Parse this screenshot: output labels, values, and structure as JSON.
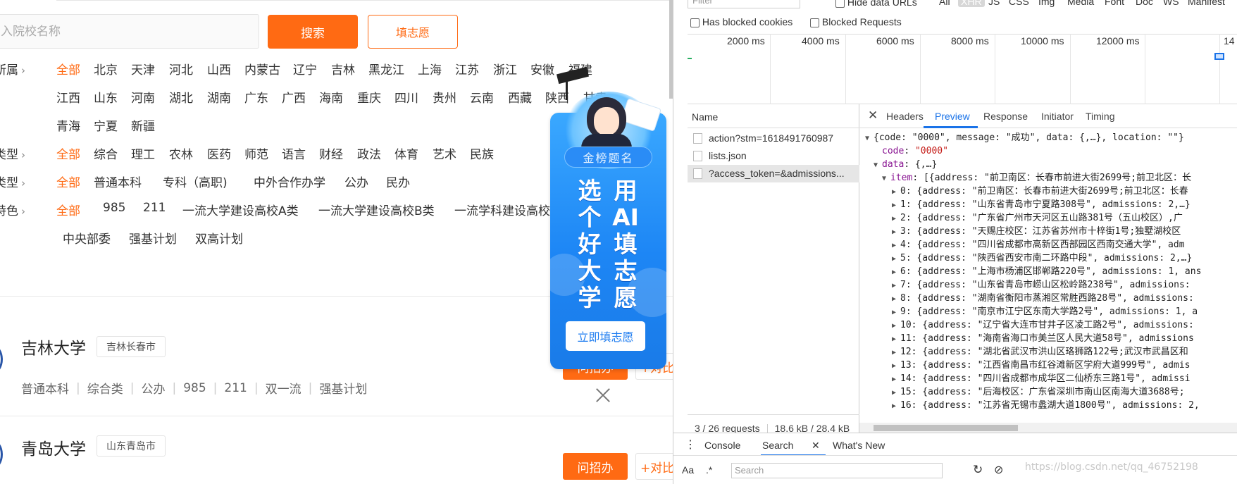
{
  "search": {
    "placeholder": "入院校名称",
    "search_button": "搜索",
    "fill_button": "填志愿"
  },
  "filters": [
    {
      "label": "所属",
      "options": [
        "全部",
        "北京",
        "天津",
        "河北",
        "山西",
        "内蒙古",
        "辽宁",
        "吉林",
        "黑龙江",
        "上海",
        "江苏",
        "浙江",
        "安徽",
        "福建",
        "江西",
        "山东",
        "河南",
        "湖北",
        "湖南",
        "广东",
        "广西",
        "海南",
        "重庆",
        "四川",
        "贵州",
        "云南",
        "西藏",
        "陕西",
        "甘肃",
        "青海",
        "宁夏",
        "新疆"
      ]
    },
    {
      "label": "类型",
      "options": [
        "全部",
        "综合",
        "理工",
        "农林",
        "医药",
        "师范",
        "语言",
        "财经",
        "政法",
        "体育",
        "艺术",
        "民族"
      ]
    },
    {
      "label": "类型",
      "options": [
        "全部",
        "普通本科",
        "专科（高职)",
        "中外合作办学",
        "公办",
        "民办"
      ]
    },
    {
      "label": "特色",
      "options": [
        "全部",
        "985",
        "211",
        "一流大学建设高校A类",
        "一流大学建设高校B类",
        "一流学科建设高校",
        "中央部委",
        "强基计划",
        "双高计划"
      ]
    }
  ],
  "universities": [
    {
      "name": "吉林大学",
      "location": "吉林长春市",
      "tags": [
        "普通本科",
        "综合类",
        "公办",
        "985",
        "211",
        "双一流",
        "强基计划"
      ],
      "enroll": "问招办",
      "compare": "+对比"
    },
    {
      "name": "青岛大学",
      "location": "山东青岛市",
      "tags": [],
      "enroll": "问招办",
      "compare": "+对比"
    }
  ],
  "ad": {
    "pill": "金榜题名",
    "col1": [
      "选",
      "个",
      "好",
      "大",
      "学"
    ],
    "col2": [
      "用",
      "AI",
      "填",
      "志",
      "愿"
    ],
    "cta": "立即填志愿"
  },
  "devtools": {
    "filter_placeholder": "Filter",
    "hide_data_urls": "Hide data URLs",
    "types": [
      "All",
      "XHR",
      "JS",
      "CSS",
      "Img",
      "Media",
      "Font",
      "Doc",
      "WS",
      "Manifest"
    ],
    "has_blocked_cookies": "Has blocked cookies",
    "blocked_requests": "Blocked Requests",
    "ticks": [
      "2000 ms",
      "4000 ms",
      "6000 ms",
      "8000 ms",
      "10000 ms",
      "12000 ms",
      "14"
    ],
    "name_header": "Name",
    "requests": [
      "action?stm=1618491760987",
      "lists.json",
      "?access_token=&admissions..."
    ],
    "status_requests": "3 / 26 requests",
    "status_size": "18.6 kB / 28.4 kB",
    "tabs": [
      "Headers",
      "Preview",
      "Response",
      "Initiator",
      "Timing"
    ],
    "preview": {
      "root": "{code: \"0000\", message: \"成功\", data: {,…}, location: \"\"}",
      "code_key": "code",
      "code_val": "\"0000\"",
      "data_key": "data",
      "data_val": "{,…}",
      "item_key": "item",
      "item_val": "[{address: \"前卫南区：长春市前进大街2699号;前卫北区：长",
      "items": [
        "0: {address: \"前卫南区：长春市前进大街2699号;前卫北区：长春",
        "1: {address: \"山东省青岛市宁夏路308号\", admissions: 2,…}",
        "2: {address: \"广东省广州市天河区五山路381号（五山校区）,广",
        "3: {address: \"天赐庄校区：江苏省苏州市十梓街1号;独墅湖校区",
        "4: {address: \"四川省成都市高新区西部园区西南交通大学\", adm",
        "5: {address: \"陕西省西安市南二环路中段\", admissions: 2,…}",
        "6: {address: \"上海市杨浦区邯郸路220号\", admissions: 1, ans",
        "7: {address: \"山东省青岛市崂山区松岭路238号\", admissions:",
        "8: {address: \"湖南省衡阳市蒸湘区常胜西路28号\", admissions:",
        "9: {address: \"南京市江宁区东南大学路2号\", admissions: 1, a",
        "10: {address: \"辽宁省大连市甘井子区凌工路2号\", admissions:",
        "11: {address: \"海南省海口市美兰区人民大道58号\", admissions",
        "12: {address: \"湖北省武汉市洪山区珞狮路122号;武汉市武昌区和",
        "13: {address: \"江西省南昌市红谷滩新区学府大道999号\", admis",
        "14: {address: \"四川省成都市成华区二仙桥东三路1号\", admissi",
        "15: {address: \"后海校区：广东省深圳市南山区南海大道3688号;",
        "16: {address: \"江苏省无锡市蠡湖大道1800号\", admissions: 2,"
      ]
    },
    "drawer_tabs": [
      "Console",
      "Search",
      "What's New"
    ],
    "search_placeholder": "Search",
    "aa": "Aa",
    "regex": ".*"
  },
  "watermark": "https://blog.csdn.net/qq_46752198",
  "colors": {
    "accent": "#ff6a13",
    "devtools_blue": "#1a73e8",
    "ad_blue": "#1d86f5"
  }
}
